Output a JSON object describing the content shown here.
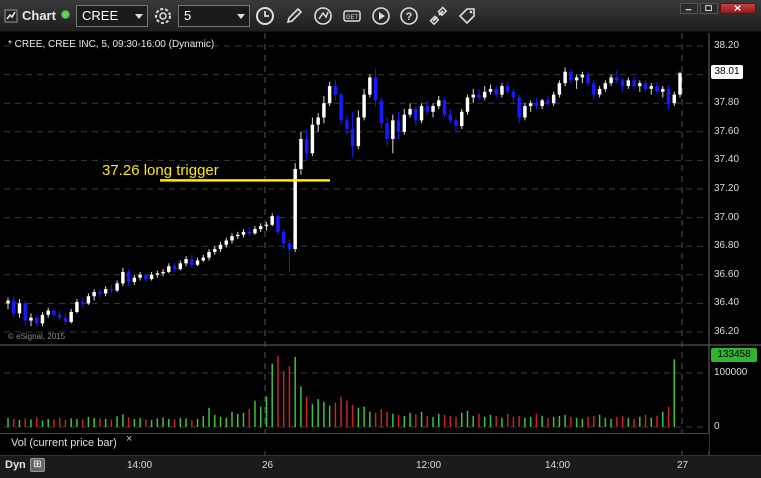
{
  "toolbar": {
    "app_title": "Chart",
    "symbol": "CREE",
    "interval": "5",
    "icons": [
      "chart-app-icon",
      "status-dot",
      "symbol-combo",
      "settings-gear-icon",
      "interval-combo",
      "clock-icon",
      "pencil-icon",
      "cursor-icon",
      "get-data-icon",
      "play-icon",
      "help-icon",
      "link-icon",
      "tag-icon",
      "minimize",
      "maximize",
      "close"
    ]
  },
  "header": {
    "text": "* CREE, CREE INC, 5, 09:30-16:00 (Dynamic)"
  },
  "watermark": "© eSignal, 2015",
  "annotation": {
    "text": "37.26 long trigger",
    "line_color": "#ffea00"
  },
  "colors": {
    "up": "#ffffff",
    "down": "#1a1aff",
    "vol_up": "#3cc43c",
    "vol_down": "#cc2222",
    "grid": "#3a3a3a",
    "last_badge": "#ffffff",
    "vol_badge": "#2fb52f"
  },
  "price_axis": {
    "ticks": [
      "38.20",
      "38.00",
      "37.80",
      "37.60",
      "37.40",
      "37.20",
      "37.00",
      "36.80",
      "36.60",
      "36.40",
      "36.20"
    ],
    "last_price": "38.01"
  },
  "volume_axis": {
    "ticks": [
      "100000",
      "0"
    ],
    "last_volume": "133458"
  },
  "study": {
    "label": "Vol (current price bar)",
    "close": "×"
  },
  "time_axis": {
    "dyn_label": "Dyn",
    "dyn_icon": "⊞",
    "ticks": [
      "14:00",
      "26",
      "12:00",
      "14:00",
      "27"
    ]
  },
  "chart_data": {
    "type": "candlestick",
    "trigger_price": 37.26,
    "ylim": [
      36.1,
      38.3
    ],
    "prices": [
      [
        36.4,
        36.44,
        36.36,
        36.42
      ],
      [
        36.42,
        36.45,
        36.3,
        36.33
      ],
      [
        36.33,
        36.43,
        36.3,
        36.4
      ],
      [
        36.4,
        36.42,
        36.25,
        36.28
      ],
      [
        36.28,
        36.33,
        36.24,
        36.3
      ],
      [
        36.3,
        36.32,
        36.24,
        36.26
      ],
      [
        36.26,
        36.34,
        36.24,
        36.32
      ],
      [
        36.32,
        36.37,
        36.3,
        36.35
      ],
      [
        36.35,
        36.36,
        36.3,
        36.32
      ],
      [
        36.32,
        36.35,
        36.28,
        36.3
      ],
      [
        36.3,
        36.33,
        36.25,
        36.27
      ],
      [
        36.27,
        36.36,
        36.26,
        36.34
      ],
      [
        36.34,
        36.43,
        36.33,
        36.41
      ],
      [
        36.41,
        36.44,
        36.37,
        36.4
      ],
      [
        36.4,
        36.47,
        36.39,
        36.45
      ],
      [
        36.45,
        36.5,
        36.42,
        36.48
      ],
      [
        36.48,
        36.5,
        36.44,
        36.47
      ],
      [
        36.47,
        36.52,
        36.45,
        36.5
      ],
      [
        36.5,
        36.53,
        36.47,
        36.49
      ],
      [
        36.49,
        36.56,
        36.48,
        36.54
      ],
      [
        36.54,
        36.65,
        36.52,
        36.62
      ],
      [
        36.62,
        36.64,
        36.52,
        36.55
      ],
      [
        36.55,
        36.6,
        36.53,
        36.58
      ],
      [
        36.58,
        36.62,
        36.56,
        36.6
      ],
      [
        36.6,
        36.61,
        36.55,
        36.57
      ],
      [
        36.57,
        36.62,
        36.56,
        36.6
      ],
      [
        36.6,
        36.63,
        36.58,
        36.61
      ],
      [
        36.61,
        36.64,
        36.59,
        36.62
      ],
      [
        36.62,
        36.68,
        36.61,
        36.66
      ],
      [
        36.66,
        36.68,
        36.62,
        36.64
      ],
      [
        36.64,
        36.7,
        36.63,
        36.68
      ],
      [
        36.68,
        36.73,
        36.66,
        36.71
      ],
      [
        36.71,
        36.74,
        36.65,
        36.67
      ],
      [
        36.67,
        36.72,
        36.66,
        36.7
      ],
      [
        36.7,
        36.74,
        36.69,
        36.72
      ],
      [
        36.72,
        36.78,
        36.7,
        36.76
      ],
      [
        36.76,
        36.8,
        36.74,
        36.78
      ],
      [
        36.78,
        36.83,
        36.76,
        36.81
      ],
      [
        36.81,
        36.86,
        36.79,
        36.84
      ],
      [
        36.84,
        36.89,
        36.82,
        36.87
      ],
      [
        36.87,
        36.9,
        36.85,
        36.88
      ],
      [
        36.88,
        36.92,
        36.86,
        36.9
      ],
      [
        36.9,
        36.93,
        36.87,
        36.89
      ],
      [
        36.89,
        36.94,
        36.88,
        36.92
      ],
      [
        36.92,
        36.96,
        36.9,
        36.94
      ],
      [
        36.94,
        36.97,
        36.91,
        36.95
      ],
      [
        36.95,
        37.03,
        36.94,
        37.01
      ],
      [
        37.01,
        37.02,
        36.88,
        36.9
      ],
      [
        36.9,
        36.92,
        36.78,
        36.82
      ],
      [
        36.82,
        36.85,
        36.62,
        36.78
      ],
      [
        36.78,
        37.38,
        36.76,
        37.34
      ],
      [
        37.34,
        37.6,
        37.3,
        37.55
      ],
      [
        37.55,
        37.62,
        37.4,
        37.45
      ],
      [
        37.45,
        37.7,
        37.43,
        37.65
      ],
      [
        37.65,
        37.73,
        37.6,
        37.7
      ],
      [
        37.7,
        37.85,
        37.66,
        37.8
      ],
      [
        37.8,
        37.95,
        37.78,
        37.92
      ],
      [
        37.92,
        37.96,
        37.82,
        37.86
      ],
      [
        37.86,
        37.88,
        37.65,
        37.68
      ],
      [
        37.68,
        37.72,
        37.58,
        37.62
      ],
      [
        37.62,
        37.74,
        37.42,
        37.5
      ],
      [
        37.5,
        37.75,
        37.48,
        37.7
      ],
      [
        37.7,
        37.9,
        37.68,
        37.86
      ],
      [
        37.86,
        38.0,
        37.84,
        37.98
      ],
      [
        37.98,
        38.04,
        37.78,
        37.82
      ],
      [
        37.82,
        37.84,
        37.62,
        37.66
      ],
      [
        37.66,
        37.7,
        37.5,
        37.55
      ],
      [
        37.55,
        37.72,
        37.45,
        37.68
      ],
      [
        37.68,
        37.74,
        37.55,
        37.6
      ],
      [
        37.6,
        37.76,
        37.58,
        37.72
      ],
      [
        37.72,
        37.8,
        37.7,
        37.76
      ],
      [
        37.76,
        37.78,
        37.64,
        37.68
      ],
      [
        37.68,
        37.8,
        37.66,
        37.78
      ],
      [
        37.78,
        37.82,
        37.72,
        37.74
      ],
      [
        37.74,
        37.8,
        37.7,
        37.78
      ],
      [
        37.78,
        37.85,
        37.76,
        37.82
      ],
      [
        37.82,
        37.84,
        37.7,
        37.72
      ],
      [
        37.72,
        37.76,
        37.66,
        37.68
      ],
      [
        37.68,
        37.7,
        37.6,
        37.64
      ],
      [
        37.64,
        37.76,
        37.62,
        37.74
      ],
      [
        37.74,
        37.86,
        37.72,
        37.84
      ],
      [
        37.84,
        37.9,
        37.8,
        37.86
      ],
      [
        37.86,
        37.9,
        37.82,
        37.84
      ],
      [
        37.84,
        37.92,
        37.82,
        37.88
      ],
      [
        37.88,
        37.93,
        37.86,
        37.9
      ],
      [
        37.9,
        37.92,
        37.84,
        37.86
      ],
      [
        37.86,
        37.94,
        37.84,
        37.92
      ],
      [
        37.92,
        37.95,
        37.86,
        37.88
      ],
      [
        37.88,
        37.9,
        37.8,
        37.84
      ],
      [
        37.84,
        37.86,
        37.66,
        37.7
      ],
      [
        37.7,
        37.8,
        37.68,
        37.78
      ],
      [
        37.78,
        37.82,
        37.74,
        37.8
      ],
      [
        37.8,
        37.84,
        37.76,
        37.78
      ],
      [
        37.78,
        37.83,
        37.76,
        37.82
      ],
      [
        37.82,
        37.85,
        37.78,
        37.8
      ],
      [
        37.8,
        37.88,
        37.78,
        37.86
      ],
      [
        37.86,
        37.96,
        37.84,
        37.94
      ],
      [
        37.94,
        38.05,
        37.92,
        38.02
      ],
      [
        38.02,
        38.04,
        37.94,
        37.96
      ],
      [
        37.96,
        38.0,
        37.9,
        37.98
      ],
      [
        37.98,
        38.02,
        37.94,
        38.0
      ],
      [
        38.0,
        38.02,
        37.92,
        37.94
      ],
      [
        37.94,
        37.96,
        37.82,
        37.86
      ],
      [
        37.86,
        37.92,
        37.84,
        37.9
      ],
      [
        37.9,
        37.96,
        37.88,
        37.94
      ],
      [
        37.94,
        38.0,
        37.92,
        37.98
      ],
      [
        37.98,
        38.03,
        37.94,
        37.96
      ],
      [
        37.96,
        37.98,
        37.88,
        37.92
      ],
      [
        37.92,
        37.98,
        37.9,
        37.96
      ],
      [
        37.96,
        37.99,
        37.9,
        37.92
      ],
      [
        37.92,
        37.96,
        37.88,
        37.94
      ],
      [
        37.94,
        37.96,
        37.88,
        37.9
      ],
      [
        37.9,
        37.94,
        37.86,
        37.92
      ],
      [
        37.92,
        37.95,
        37.86,
        37.88
      ],
      [
        37.88,
        37.92,
        37.84,
        37.9
      ],
      [
        37.9,
        37.92,
        37.76,
        37.8
      ],
      [
        37.8,
        37.88,
        37.78,
        37.86
      ],
      [
        37.86,
        38.02,
        37.84,
        38.01
      ]
    ],
    "volumes": [
      18000,
      16000,
      14000,
      17000,
      15000,
      19000,
      13000,
      16000,
      15000,
      18000,
      14000,
      17000,
      16000,
      15000,
      20000,
      18000,
      17000,
      16000,
      15000,
      21000,
      25000,
      19000,
      16000,
      18000,
      15000,
      14000,
      17000,
      19000,
      16000,
      15000,
      18000,
      17000,
      14000,
      16000,
      22000,
      38000,
      24000,
      20000,
      18000,
      30000,
      26000,
      28000,
      35000,
      52000,
      40000,
      60000,
      125000,
      140000,
      110000,
      120000,
      138000,
      80000,
      60000,
      45000,
      55000,
      50000,
      42000,
      48000,
      60000,
      52000,
      44000,
      38000,
      40000,
      30000,
      28000,
      35000,
      30000,
      26000,
      24000,
      22000,
      28000,
      25000,
      30000,
      22000,
      20000,
      26000,
      24000,
      22000,
      20000,
      28000,
      32000,
      22000,
      26000,
      20000,
      24000,
      22000,
      18000,
      26000,
      20000,
      22000,
      18000,
      20000,
      26000,
      22000,
      18000,
      20000,
      22000,
      24000,
      20000,
      18000,
      16000,
      20000,
      22000,
      24000,
      18000,
      16000,
      20000,
      22000,
      18000,
      16000,
      20000,
      24000,
      18000,
      22000,
      30000,
      40000,
      133458
    ]
  }
}
